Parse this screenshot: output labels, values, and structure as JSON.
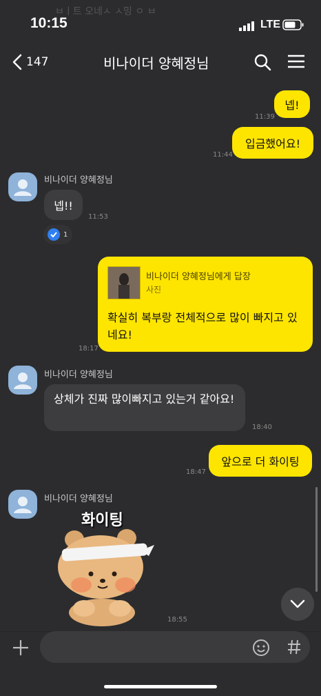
{
  "status": {
    "time": "10:15",
    "network": "LTE",
    "overlay": "ㅂㅣ트 오네ㅅ ㅅ밍 ㅇ ㅂ"
  },
  "header": {
    "back_count": "147",
    "title": "비나이더 양혜정님"
  },
  "messages": {
    "m1": {
      "text": "넵!",
      "time": "11:39"
    },
    "m2": {
      "text": "입금했어요!",
      "time": "11:44"
    },
    "m3": {
      "sender": "비나이더 양혜정님",
      "text": "넵!!",
      "time": "11:53",
      "reaction_count": "1"
    },
    "m4": {
      "reply_to": "비나이더 양혜정님에게 답장",
      "reply_type": "사진",
      "text": "확실히 복부랑 전체적으로 많이 빠지고 있네요!",
      "time": "18:17"
    },
    "m5": {
      "sender": "비나이더 양혜정님",
      "text": "상체가 진짜 많이빠지고 있는거 같아요!",
      "time": "18:40"
    },
    "m6": {
      "text": "앞으로 더 화이팅",
      "time": "18:47"
    },
    "m7": {
      "sender": "비나이더 양혜정님",
      "sticker_text": "화이팅",
      "time": "18:55"
    }
  },
  "composer": {
    "placeholder": ""
  },
  "colors": {
    "bubble_yellow": "#fee500",
    "background": "#2c2c2e"
  }
}
